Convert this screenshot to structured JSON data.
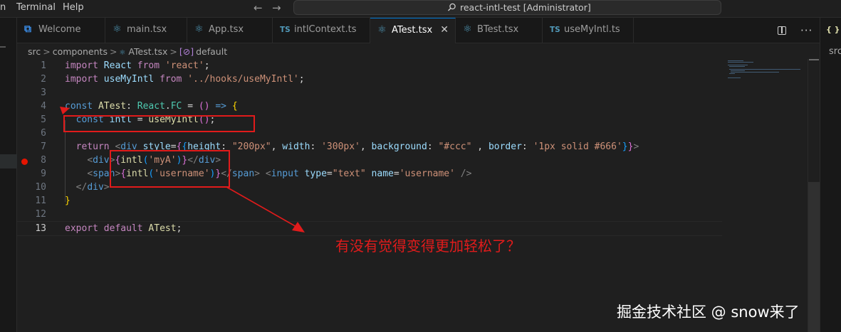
{
  "menu": {
    "items": [
      "n",
      "Terminal",
      "Help"
    ]
  },
  "title_bar": {
    "back_arrow": "←",
    "forward_arrow": "→",
    "command_center_icon": "search-icon",
    "command_center_text": "react-intl-test [Administrator]"
  },
  "tabs": [
    {
      "label": "Welcome",
      "icon": "vscode-icon",
      "glyph": "⧉",
      "active": false
    },
    {
      "label": "main.tsx",
      "icon": "react-icon",
      "glyph": "⚛",
      "active": false
    },
    {
      "label": "App.tsx",
      "icon": "react-icon",
      "glyph": "⚛",
      "active": false
    },
    {
      "label": "intlContext.ts",
      "icon": "typescript-icon",
      "glyph": "TS",
      "active": false
    },
    {
      "label": "ATest.tsx",
      "icon": "react-icon",
      "glyph": "⚛",
      "active": true
    },
    {
      "label": "BTest.tsx",
      "icon": "react-icon",
      "glyph": "⚛",
      "active": false
    },
    {
      "label": "useMyIntl.ts",
      "icon": "typescript-icon",
      "glyph": "TS",
      "active": false
    }
  ],
  "active_tab_close": "✕",
  "editor_actions": {
    "split_editor_icon": "split-editor-icon",
    "more_actions": "···"
  },
  "breadcrumb": {
    "parts": [
      "src",
      "components",
      "ATest.tsx",
      "default"
    ],
    "separator": ">",
    "file_icon": "⚛",
    "symbol_icon": "[⊘]"
  },
  "code": {
    "line_numbers": [
      "1",
      "2",
      "3",
      "4",
      "5",
      "6",
      "7",
      "8",
      "9",
      "10",
      "11",
      "12",
      "13"
    ],
    "current_line": 13,
    "breakpoint_line": 8,
    "lines": [
      "import React from 'react';",
      "import useMyIntl from '../hooks/useMyIntl';",
      "",
      "const ATest: React.FC = () => {",
      "  const intl = useMyIntl();",
      "",
      "  return <div style={{height: \"200px\", width: '300px', background: \"#ccc\" , border: '1px solid #666'}}>",
      "    <div>{intl('myA')}</div>",
      "    <span>{intl('username')}</span> <input type=\"text\" name='username' />",
      "  </div>",
      "}",
      "",
      "export default ATest;"
    ]
  },
  "right_panel": {
    "icon": "{ }",
    "text": "src"
  },
  "annotations": {
    "note": "有没有觉得变得更加轻松了？",
    "color": "#e11b1b"
  },
  "watermark": "掘金技术社区 @ snow来了",
  "colors": {
    "accent": "#0078d4",
    "editor_bg": "#1f1f1f",
    "breakpoint": "#e51400"
  }
}
